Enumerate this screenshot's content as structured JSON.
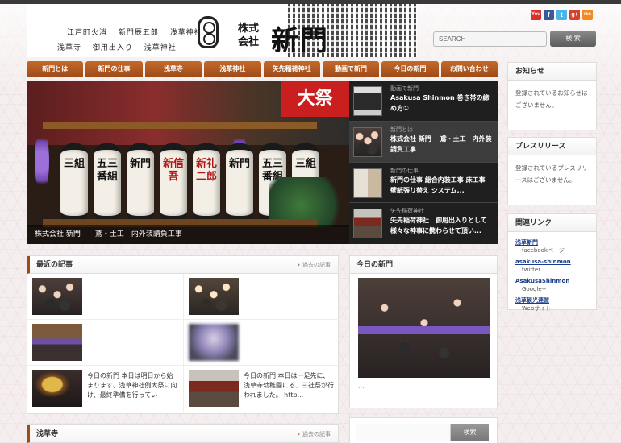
{
  "header": {
    "motto_lines": [
      "江戸町火消　　新門辰五郎　　浅草神社",
      "浅草寺　　御用出入り　　浅草神社"
    ],
    "motto_1a": "江戸町火消",
    "motto_1b": "新門辰五郎",
    "motto_1c": "浅草神社",
    "motto_2a": "浅草寺",
    "motto_2b": "御用出入り",
    "motto_2c": "浅草神社",
    "kabushiki_top": "株式",
    "kabushiki_bottom": "会社",
    "brand": "新門",
    "search_placeholder": "SEARCH",
    "search_button": "検 索",
    "social": [
      {
        "label": "You",
        "color": "#d9302a"
      },
      {
        "label": "f",
        "color": "#3b5998"
      },
      {
        "label": "t",
        "color": "#4ab3e8"
      },
      {
        "label": "g+",
        "color": "#d5422f"
      },
      {
        "label": "rss",
        "color": "#f08a24"
      }
    ]
  },
  "nav": [
    "新門とは",
    "新門の仕事",
    "浅草寺",
    "浅草神社",
    "矢先稲荷神社",
    "動画で新門",
    "今日の新門",
    "お問い合わせ"
  ],
  "hero": {
    "caption": "株式会社 新門　　鳶・土工　内外装請負工事",
    "banner": "大祭",
    "lanterns": [
      "三組",
      "五三番組",
      "新門",
      "新信吾",
      "新礼二郎",
      "新門",
      "五三番組",
      "三組"
    ]
  },
  "features": [
    {
      "cat": "動画で新門",
      "title": "Asakusa Shinmon 巻き帯の締め方①"
    },
    {
      "cat": "新門とは",
      "title": "株式会社 新門　 鳶・土工　内外装請負工事"
    },
    {
      "cat": "新門の仕事",
      "title": "新門の仕事 総合内装工事 床工事 壁紙張り替え システム..."
    },
    {
      "cat": "矢先稲荷神社",
      "title": "矢先稲荷神社　御用出入りとして様々な神事に携わらせて頂い..."
    }
  ],
  "recent": {
    "title": "最近の記事",
    "more": "過去の記事",
    "posts": [
      {
        "text": ""
      },
      {
        "text": ""
      },
      {
        "text": ""
      },
      {
        "text": ""
      },
      {
        "text": "今日の新門 本日は明日から始まります、浅草神社例大祭に向け、最終準備を行ってい"
      },
      {
        "text": "今日の新門 本日は一足先に、浅草寺幼稚園にる、三社祭が行われました。 http..."
      }
    ]
  },
  "today": {
    "title": "今日の新門",
    "dots": "..."
  },
  "sensoji": {
    "title": "浅草寺",
    "more": "過去の記事"
  },
  "bottom_search_button": "検索",
  "sidebar": {
    "news_title": "お知らせ",
    "news_body": "登録されているお知らせはございません。",
    "press_title": "プレスリリース",
    "press_body": "登録されているプレスリリースはございません。",
    "links_title": "関連リンク",
    "links": [
      {
        "name": "浅草新門",
        "sub": "facebookページ"
      },
      {
        "name": "asakusa-shinmon",
        "sub": "twitter"
      },
      {
        "name": "AsakusaShinmon",
        "sub": "Google+"
      },
      {
        "name": "浅草観光連盟",
        "sub": "Webサイト"
      }
    ]
  }
}
